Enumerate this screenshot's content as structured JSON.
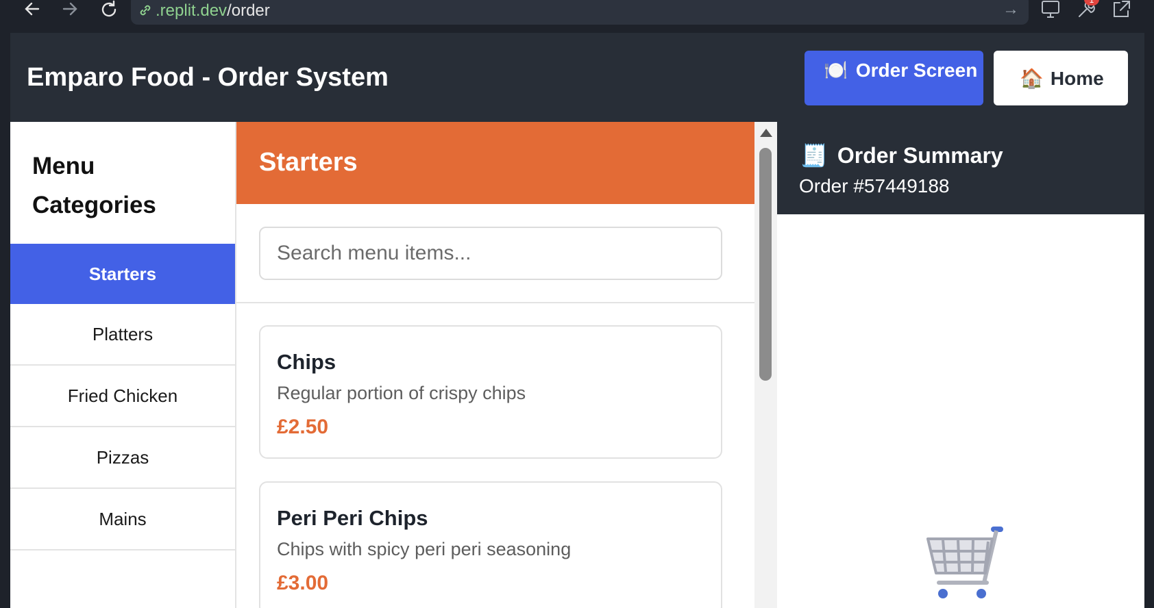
{
  "browser": {
    "url_host": ".replit.dev",
    "url_path": "/order",
    "back_icon": "arrow-left-icon",
    "forward_icon": "arrow-right-icon",
    "reload_icon": "reload-icon",
    "notification_count": "1"
  },
  "header": {
    "title": "Emparo Food - Order System",
    "order_screen_label": "Order Screen",
    "order_screen_icon": "🍽️",
    "home_label": "Home",
    "home_icon": "🏠",
    "accent": "#4361e6",
    "background": "#282e37"
  },
  "sidebar": {
    "title": "Menu Categories",
    "items": [
      {
        "label": "Starters",
        "active": true
      },
      {
        "label": "Platters",
        "active": false
      },
      {
        "label": "Fried Chicken",
        "active": false
      },
      {
        "label": "Pizzas",
        "active": false
      },
      {
        "label": "Mains",
        "active": false
      }
    ]
  },
  "main": {
    "section_title": "Starters",
    "section_color": "#e36b36",
    "search_placeholder": "Search menu items...",
    "items": [
      {
        "name": "Chips",
        "description": "Regular portion of crispy chips",
        "price": "£2.50"
      },
      {
        "name": "Peri Peri Chips",
        "description": "Chips with spicy peri peri seasoning",
        "price": "£3.00"
      }
    ]
  },
  "summary": {
    "icon": "🧾",
    "title": "Order Summary",
    "order_number": "Order #57449188",
    "empty_icon": "shopping-cart-icon"
  }
}
